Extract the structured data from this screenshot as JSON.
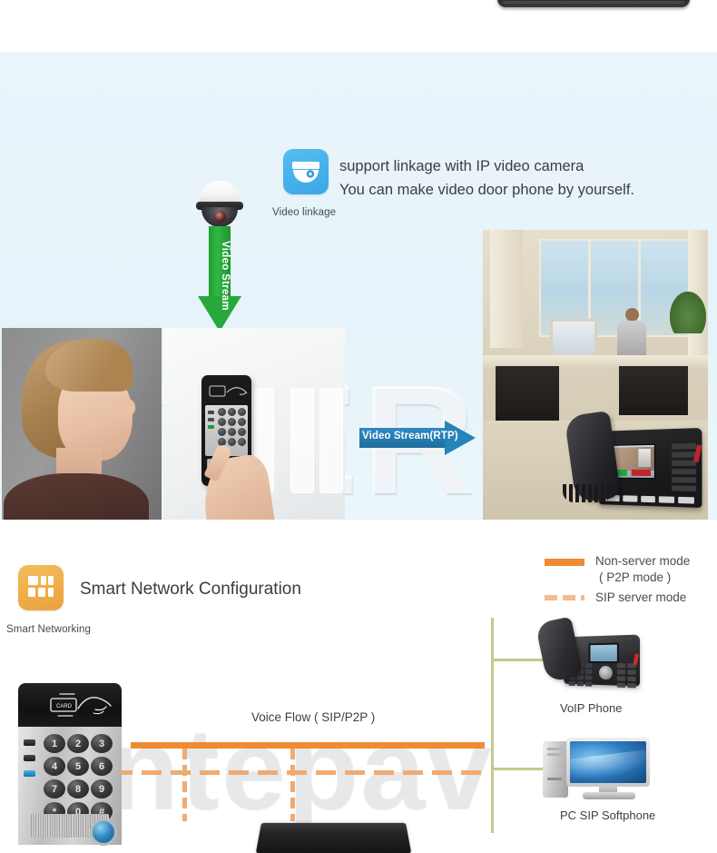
{
  "page": {
    "watermark_top": "ITER",
    "watermark_bottom": "ntepav"
  },
  "top_device": {
    "name": "black-device-edge"
  },
  "video_section": {
    "icon_name": "video-camera-icon",
    "icon_caption": "Video linkage",
    "headline_line1": "support linkage with IP video camera",
    "headline_line2": "You can make video door phone by yourself.",
    "camera_name": "ip-dome-camera",
    "green_arrow_label": "Video Stream",
    "blue_arrow_label": "Video Stream(RTP)",
    "photos": [
      {
        "name": "woman-profile-photo",
        "alt": "woman looking at door phone"
      },
      {
        "name": "door-phone-press-photo",
        "alt": "hand pressing door phone call button"
      },
      {
        "name": "office-voip-phone-photo",
        "alt": "office with VoIP video phone showing caller"
      }
    ],
    "panel_bg": "#e9f5fb",
    "green_accent": "#25a93a",
    "blue_accent": "#2683bc"
  },
  "network_section": {
    "icon_name": "smart-networking-grid-icon",
    "icon_caption": "Smart Networking",
    "title": "Smart Network Configuration",
    "legend": [
      {
        "style": "solid",
        "label": "Non-server mode",
        "label2": "( P2P mode )",
        "color": "#ef8b33"
      },
      {
        "style": "dashed",
        "label": "SIP server mode",
        "label2": "",
        "color": "#f7b98a"
      }
    ],
    "flow_label": "Voice Flow ( SIP/P2P )",
    "devices": [
      {
        "name": "voip-phone",
        "label": "VoIP Phone"
      },
      {
        "name": "pc-sip-softphone",
        "label": "PC SIP Softphone"
      }
    ],
    "door_phone": {
      "name": "sip-door-phone",
      "card_label": "CARD",
      "keypad": [
        "1",
        "2",
        "3",
        "4",
        "5",
        "6",
        "7",
        "8",
        "9",
        "*",
        "0",
        "#"
      ]
    },
    "switch_name": "network-switch",
    "connector_color": "#c6c88e"
  }
}
